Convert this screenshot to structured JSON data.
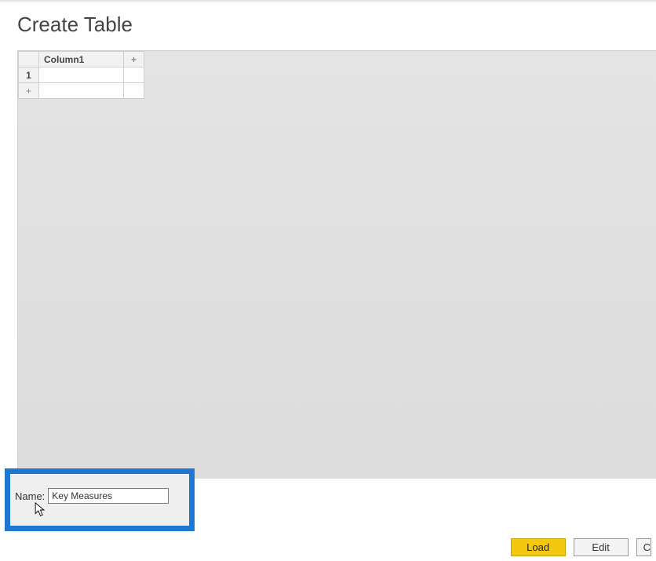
{
  "dialog": {
    "title": "Create Table"
  },
  "table": {
    "column_header": "Column1",
    "add_col_label": "+",
    "row1_number": "1",
    "row1_value": "",
    "add_row_label": "+"
  },
  "name_section": {
    "label": "Name:",
    "value": "Key Measures"
  },
  "buttons": {
    "load": "Load",
    "edit": "Edit",
    "cancel": "C"
  }
}
